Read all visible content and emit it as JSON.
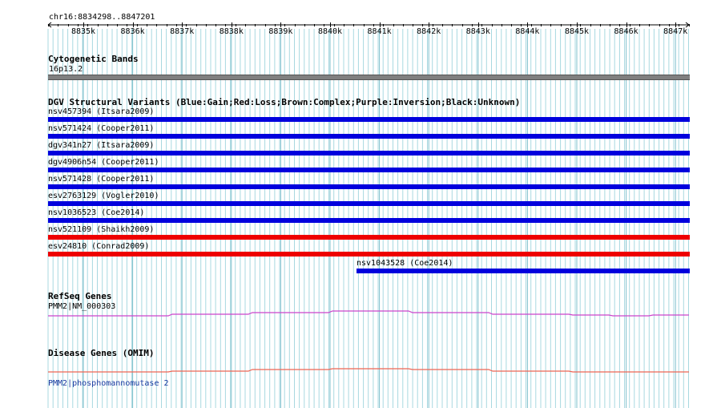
{
  "ruler": {
    "range_label": "chr16:8834298..8847201",
    "ticks": [
      "8835k",
      "8836k",
      "8837k",
      "8838k",
      "8839k",
      "8840k",
      "8841k",
      "8842k",
      "8843k",
      "8844k",
      "8845k",
      "8846k",
      "8847k"
    ]
  },
  "cytobands": {
    "title": "Cytogenetic Bands",
    "band": "16p13.2",
    "band_color": "#808080"
  },
  "dgv": {
    "title": "DGV Structural Variants (Blue:Gain;Red:Loss;Brown:Complex;Purple:Inversion;Black:Unknown)",
    "colors": {
      "gain": "#0000dd",
      "loss": "#ee0000"
    },
    "variants": [
      {
        "label": "nsv457394 (Itsara2009)",
        "type": "gain"
      },
      {
        "label": "nsv571424 (Cooper2011)",
        "type": "gain"
      },
      {
        "label": "dgv341n27 (Itsara2009)",
        "type": "gain"
      },
      {
        "label": "dgv4906n54 (Cooper2011)",
        "type": "gain"
      },
      {
        "label": "nsv571428 (Cooper2011)",
        "type": "gain"
      },
      {
        "label": "esv2763129 (Vogler2010)",
        "type": "gain"
      },
      {
        "label": "nsv1036523 (Coe2014)",
        "type": "gain"
      },
      {
        "label": "nsv521109 (Shaikh2009)",
        "type": "loss"
      },
      {
        "label": "esv24810 (Conrad2009)",
        "type": "loss"
      },
      {
        "label": "nsv1043528 (Coe2014)",
        "type": "gain"
      }
    ]
  },
  "refseq": {
    "title": "RefSeq Genes",
    "gene": "PMM2|NM_000303",
    "color": "#cc44cc"
  },
  "omim": {
    "title": "Disease Genes (OMIM)",
    "gene": "PMM2|phosphomannomutase 2",
    "color": "#ee6655",
    "label_color": "#1a3aa0"
  },
  "grid_color": "#a8d8e0"
}
